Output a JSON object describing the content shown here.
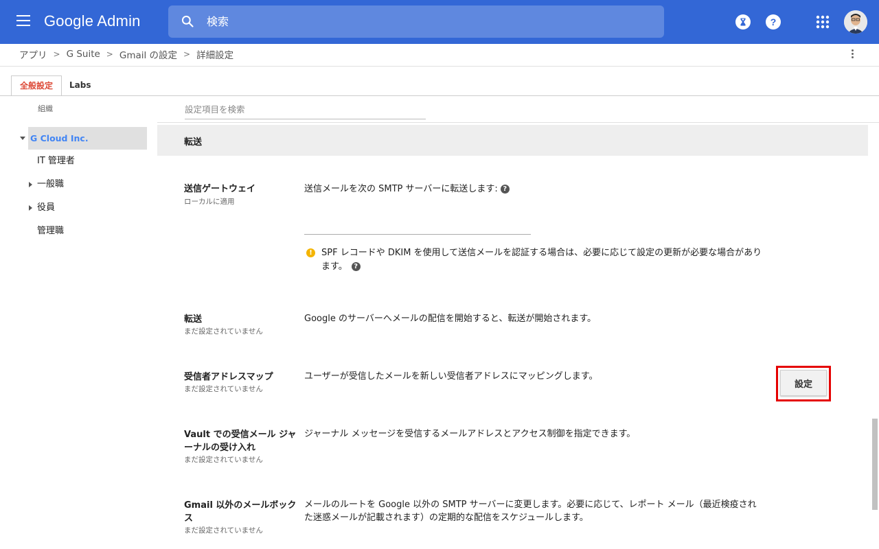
{
  "header": {
    "logo": "Google Admin",
    "search_placeholder": "検索"
  },
  "breadcrumb": [
    "アプリ",
    "G Suite",
    "Gmail の設定",
    "詳細設定"
  ],
  "tabs": [
    "全般設定",
    "Labs"
  ],
  "sidebar": {
    "title": "組織",
    "items": [
      "G Cloud Inc.",
      "IT 管理者",
      "一般職",
      "役員",
      "管理職"
    ]
  },
  "main": {
    "search_placeholder": "設定項目を検索",
    "section_title": "転送",
    "rows": [
      {
        "title": "送信ゲートウェイ",
        "subtitle": "ローカルに適用",
        "description": "送信メールを次の SMTP サーバーに転送します:",
        "warning": "SPF レコードや DKIM を使用して送信メールを認証する場合は、必要に応じて設定の更新が必要な場合があります。"
      },
      {
        "title": "転送",
        "subtitle": "まだ設定されていません",
        "description": "Google のサーバーへメールの配信を開始すると、転送が開始されます。"
      },
      {
        "title": "受信者アドレスマップ",
        "subtitle": "まだ設定されていません",
        "description": "ユーザーが受信したメールを新しい受信者アドレスにマッピングします。",
        "button": "設定"
      },
      {
        "title": "Vault での受信メール ジャーナルの受け入れ",
        "subtitle": "まだ設定されていません",
        "description": "ジャーナル メッセージを受信するメールアドレスとアクセス制御を指定できます。"
      },
      {
        "title": "Gmail 以外のメールボックス",
        "subtitle": "まだ設定されていません",
        "description": "メールのルートを Google 以外の SMTP サーバーに変更します。必要に応じて、レポート メール（最近検疫された迷惑メールが記載されます）の定期的な配信をスケジュールします。"
      }
    ]
  },
  "colors": {
    "topbar": "#3367d6",
    "accent_tab": "#dd4b39",
    "selected_org": "#4285f4",
    "highlight": "#e50000",
    "warning": "#f4b400"
  }
}
